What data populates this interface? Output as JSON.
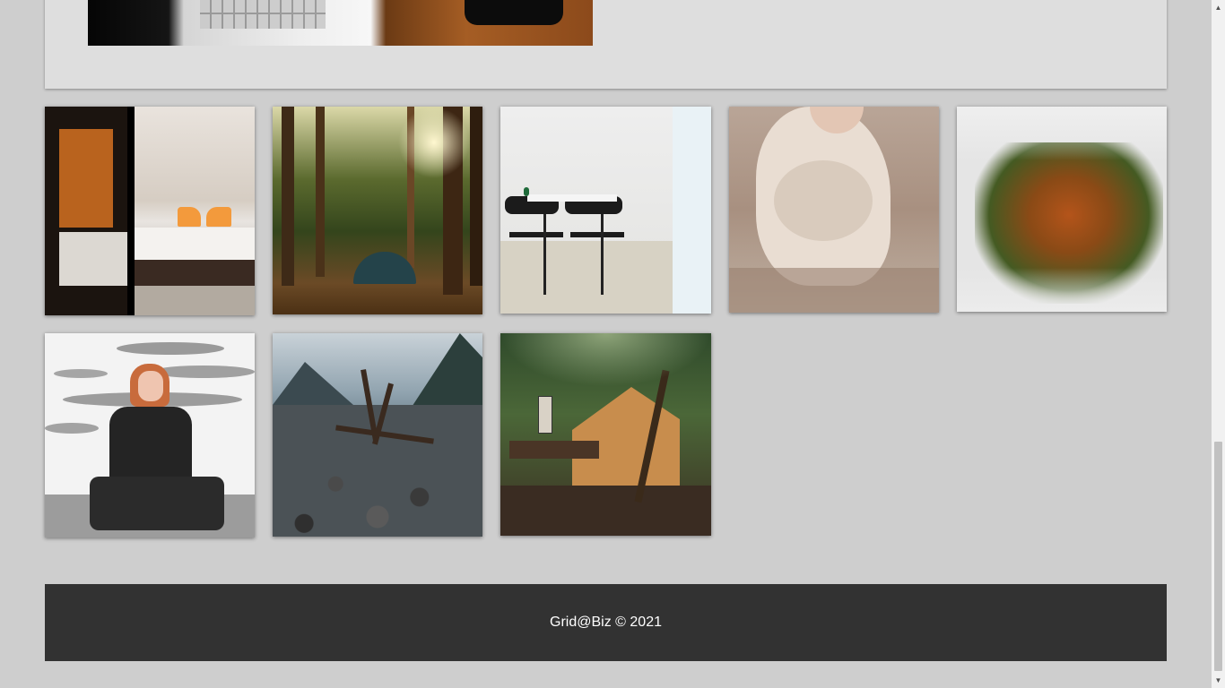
{
  "top_panel": {
    "image_alt": "laptop and phone on wooden desk"
  },
  "gallery": {
    "images": [
      {
        "alt": "hotel bedroom with orange pillows"
      },
      {
        "alt": "tent in a sunlit forest"
      },
      {
        "alt": "black chairs at white table"
      },
      {
        "alt": "figure covered in clay"
      },
      {
        "alt": "aerial autumn forest above clouds"
      },
      {
        "alt": "woman with red hair sitting on steps"
      },
      {
        "alt": "driftwood on a rocky lake shore"
      },
      {
        "alt": "old house among trees"
      }
    ]
  },
  "footer": {
    "text": "Grid@Biz © 2021"
  },
  "scrollbar": {
    "up_arrow": "▲",
    "down_arrow": "▼",
    "position": 0.97
  }
}
